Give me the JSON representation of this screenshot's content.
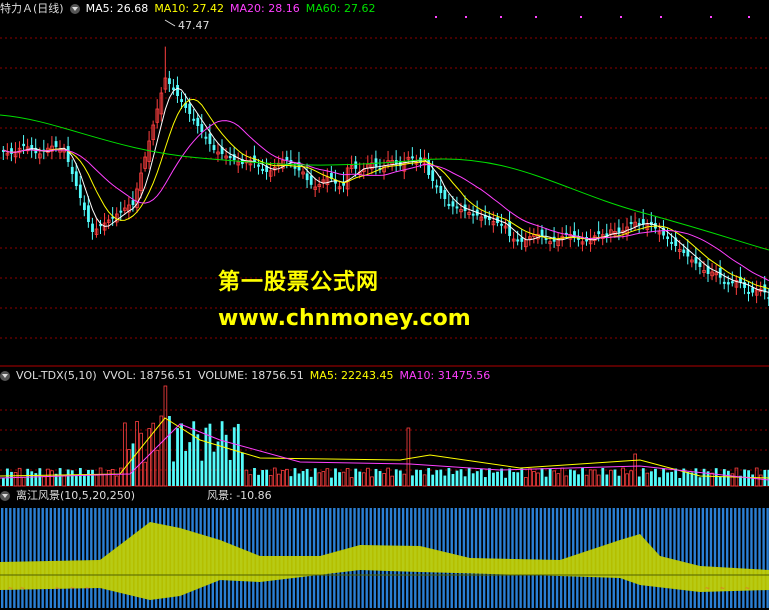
{
  "main": {
    "stock_name": "特力Ａ(日线)",
    "ma5_text": "MA5: 26.68",
    "ma10_text": "MA10: 27.42",
    "ma20_text": "MA20: 28.16",
    "ma60_text": "MA60: 27.62",
    "peak_label": "47.47",
    "watermark_title": "第一股票公式网",
    "watermark_url": "www.chnmoney.com"
  },
  "volume": {
    "indicator": "VOL-TDX(5,10)",
    "vvol_text": "VVOL: 18756.51",
    "volume_text": "VOLUME: 18756.51",
    "ma5_text": "MA5: 22243.45",
    "ma10_text": "MA10: 31475.56"
  },
  "lijiang": {
    "indicator": "离江风景(10,5,20,250)",
    "value_text": "风景: -10.86"
  },
  "colors": {
    "up": "#ff4040",
    "down": "#54fcfc",
    "ma5": "#ffffff",
    "ma10": "#ffff00",
    "ma20": "#ff40ff",
    "ma60": "#00e000",
    "grid": "#8b0000",
    "bar_blue": "#2a7fd4",
    "band_yellow": "#c8d400"
  },
  "chart_data": {
    "type": "candlestick",
    "series_count_shown": 3
  }
}
